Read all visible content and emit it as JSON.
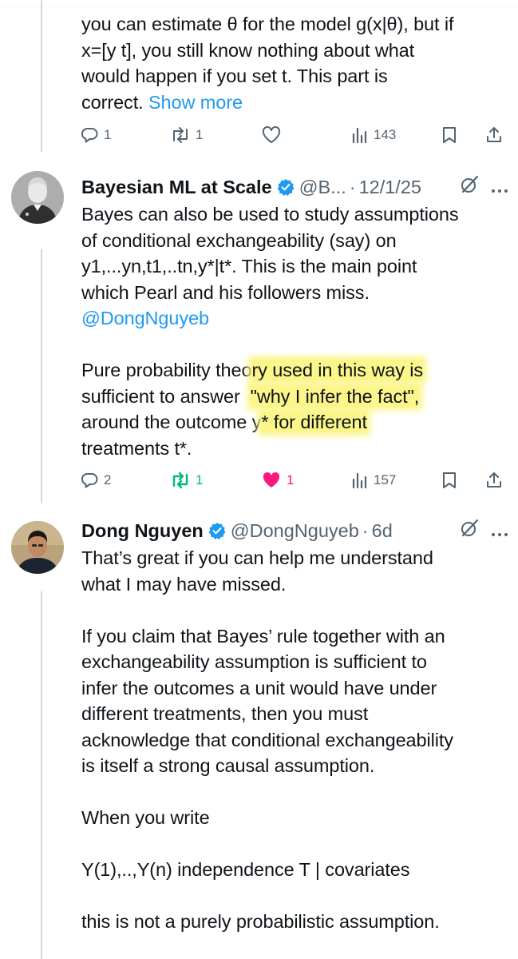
{
  "tweet1": {
    "lines": [
      "you can estimate θ for the model g(x|θ), but if",
      "x=[y t], you still know nothing about what",
      "would happen if you set t.  This part is",
      "correct. "
    ],
    "show_more": "Show more",
    "actions": {
      "replies": "1",
      "retweets": "1",
      "views": "143"
    }
  },
  "tweet2": {
    "name": "Bayesian ML at Scale",
    "handle": "@B...",
    "separator": "·",
    "date": "12/1/25",
    "lines": [
      "Bayes can also be used to study assumptions",
      "of conditional exchangeability (say) on",
      "y1,...yn,t1,..tn,y*|t*.  This is the main point",
      "which Pearl and his followers miss."
    ],
    "mention": "@DongNguyeb",
    "para2": {
      "l1_a": "Pure probability theo",
      "l1_b": "ry used in this way is",
      "l2_a": "sufficient to answer  ",
      "l2_b": "\"why I infer the fact\",",
      "l3_a": "around the outcome y",
      "l3_b": "* for different",
      "l4": "treatments t*."
    },
    "actions": {
      "replies": "2",
      "retweets": "1",
      "likes": "1",
      "views": "157"
    }
  },
  "tweet3": {
    "name": "Dong Nguyen",
    "handle": "@DongNguyeb",
    "separator": "·",
    "date": "6d",
    "para1": [
      "That’s great if you can help me understand",
      "what I may have missed."
    ],
    "para2": [
      "If you claim that Bayes’ rule together with an",
      "exchangeability assumption is sufficient to",
      "infer the outcomes a unit would have under",
      "different treatments, then you must",
      "acknowledge that conditional exchangeability",
      "is itself a strong causal assumption."
    ],
    "para3": "When you write",
    "para4": "Y(1),..,Y(n) independence T | covariates",
    "para5": "this is not a purely probabilistic assumption."
  },
  "colors": {
    "text": "#0f1419",
    "muted": "#536471",
    "link": "#1d9bf0",
    "retweet_green": "#00ba7c",
    "like_pink": "#f91880",
    "verified_blue": "#1d9bf0",
    "highlight": "#fbf58a"
  },
  "icons": [
    "reply-icon",
    "retweet-icon",
    "like-icon",
    "views-icon",
    "bookmark-icon",
    "share-icon",
    "verified-badge-icon",
    "grok-icon",
    "more-icon"
  ]
}
